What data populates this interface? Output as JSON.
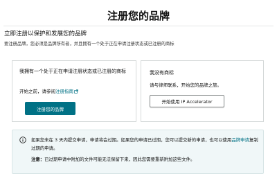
{
  "page": {
    "title": "注册您的品牌"
  },
  "intro": {
    "heading": "立即注册以保护和发展您的品牌",
    "description": "要注册品牌，您必须是品牌所有者，并且拥有一个处于正在申请注册状态或已注册的商标"
  },
  "option_left": {
    "title": "我拥有一个处于正在申请注册状态或已注册的商标",
    "note_prefix": "开始之前，请参阅",
    "guide_link": "注册指南",
    "button_label": "注册您的品牌"
  },
  "option_right": {
    "title": "我没有商标",
    "note": "请与律师联系，开始您的品牌之旅。",
    "button_label": "开始使用 IP Accelerator"
  },
  "info": {
    "text_part1": "如果您未在 3 天内提交申请，申请将会过期。如果您的申请已过期，您可以提交新的申请，也可以使用",
    "link": "品牌申请",
    "text_part2": "复制过期的申请。",
    "note_label": "注意：",
    "note_text": "已过期申请中附加的文件可能无法保留下来，因此您需要重新附加这些文件。"
  },
  "colors": {
    "primary_button": "#007185",
    "link": "#007185",
    "info_background": "#f0f7f8"
  }
}
